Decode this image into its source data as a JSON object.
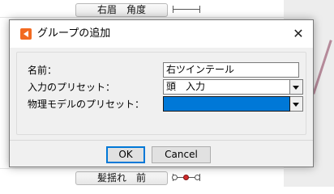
{
  "background": {
    "params": [
      {
        "label": "右眉　角度",
        "slider_red": false
      },
      {
        "label": "髪揺れ　前",
        "slider_red": true
      }
    ]
  },
  "dialog": {
    "title": "グループの追加",
    "close_label": "✕",
    "fields": {
      "name_label": "名前：",
      "name_value": "右ツインテール",
      "input_preset_label": "入力のプリセット：",
      "input_preset_value": "頭　入力",
      "physics_preset_label": "物理モデルのプリセット：",
      "physics_preset_value": ""
    },
    "buttons": {
      "ok": "OK",
      "cancel": "Cancel"
    }
  },
  "colors": {
    "selection": "#0078d7",
    "app_icon": "#f26a21",
    "slider_dot_active": "#d22b2b"
  }
}
